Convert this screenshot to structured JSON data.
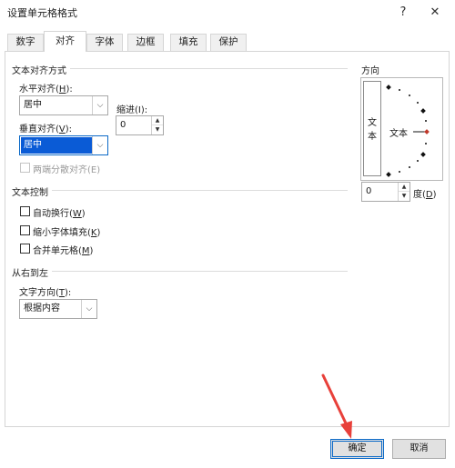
{
  "window": {
    "title": "设置单元格格式",
    "help_glyph": "?",
    "close_glyph": "✕"
  },
  "tabs": [
    {
      "label": "数字",
      "active": false
    },
    {
      "label": "对齐",
      "active": true
    },
    {
      "label": "字体",
      "active": false
    },
    {
      "label": "边框",
      "active": false
    },
    {
      "label": "填充",
      "active": false
    },
    {
      "label": "保护",
      "active": false
    }
  ],
  "text_alignment": {
    "section_title": "文本对齐方式",
    "horizontal_label": "水平对齐(",
    "horizontal_accel": "H",
    "horizontal_suffix": "):",
    "horizontal_value": "居中",
    "indent_label": "缩进(I):",
    "indent_value": "0",
    "vertical_label": "垂直对齐(",
    "vertical_accel": "V",
    "vertical_suffix": "):",
    "vertical_value": "居中",
    "justify_distributed_label": "两端分散对齐(E)"
  },
  "text_control": {
    "section_title": "文本控制",
    "wrap_label": "自动换行(",
    "wrap_accel": "W",
    "shrink_label": "缩小字体填充(",
    "shrink_accel": "K",
    "merge_label": "合并单元格(",
    "merge_accel": "M",
    "close_paren": ")"
  },
  "rtl": {
    "section_title": "从右到左",
    "direction_label": "文字方向(",
    "direction_accel": "T",
    "direction_suffix": "):",
    "direction_value": "根据内容"
  },
  "orientation": {
    "section_title": "方向",
    "vertical_text_1": "文",
    "vertical_text_2": "本",
    "dial_text": "文本",
    "degree_value": "0",
    "degree_label": "度(",
    "degree_accel": "D",
    "degree_suffix": ")"
  },
  "buttons": {
    "ok": "确定",
    "cancel": "取消"
  },
  "colors": {
    "accent": "#0b69c7",
    "selection": "#0a5bd6",
    "dial_marker": "#c0392b",
    "annotation_arrow": "#e8403a"
  },
  "annotation": {
    "arrow_target": "确定 button"
  }
}
